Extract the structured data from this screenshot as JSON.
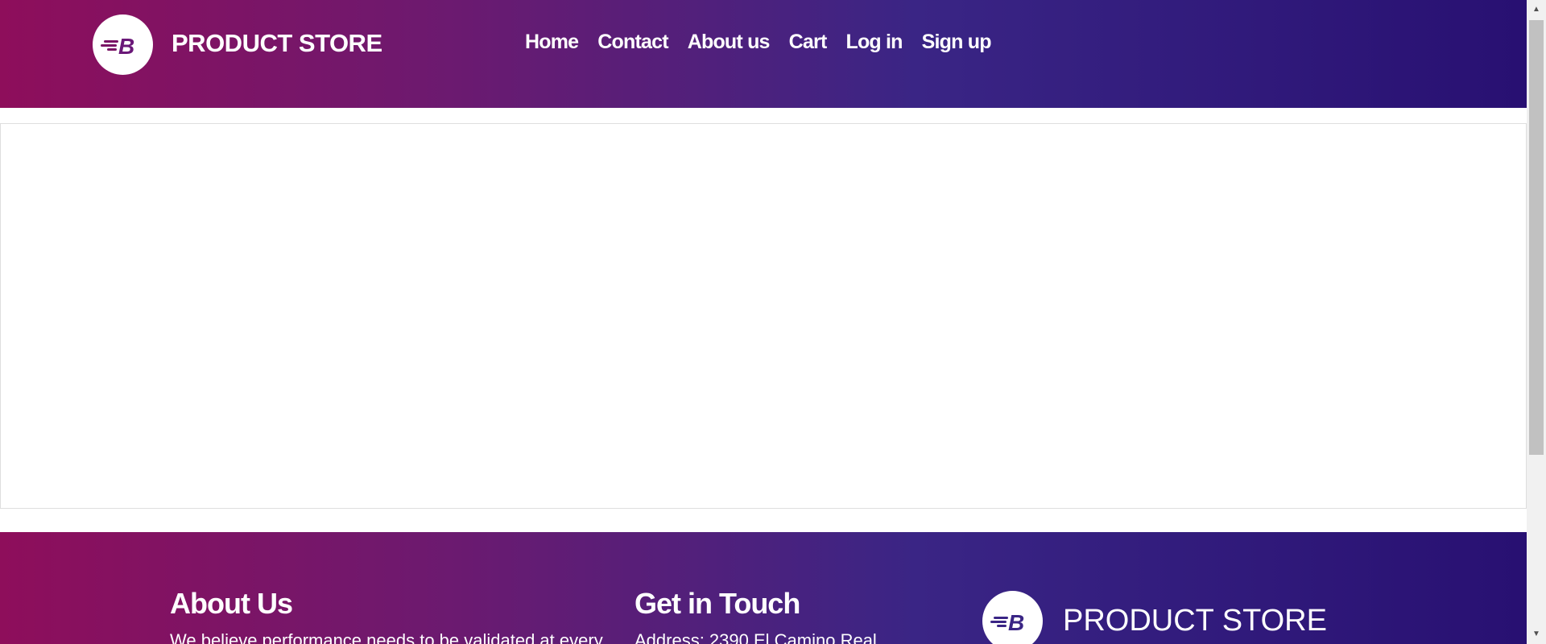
{
  "navbar": {
    "brand": "PRODUCT STORE",
    "logo_icon": "store-logo-icon",
    "items": [
      {
        "label": "Home"
      },
      {
        "label": "Contact"
      },
      {
        "label": "About us"
      },
      {
        "label": "Cart"
      },
      {
        "label": "Log in"
      },
      {
        "label": "Sign up"
      }
    ]
  },
  "footer": {
    "about": {
      "heading": "About Us",
      "text": "We believe performance needs to be validated at every"
    },
    "contact": {
      "heading": "Get in Touch",
      "text": "Address: 2390 El Camino Real"
    },
    "brand": "PRODUCT STORE"
  },
  "colors": {
    "gradient_start": "#8e0e5b",
    "gradient_end": "#281072",
    "text": "#ffffff"
  }
}
